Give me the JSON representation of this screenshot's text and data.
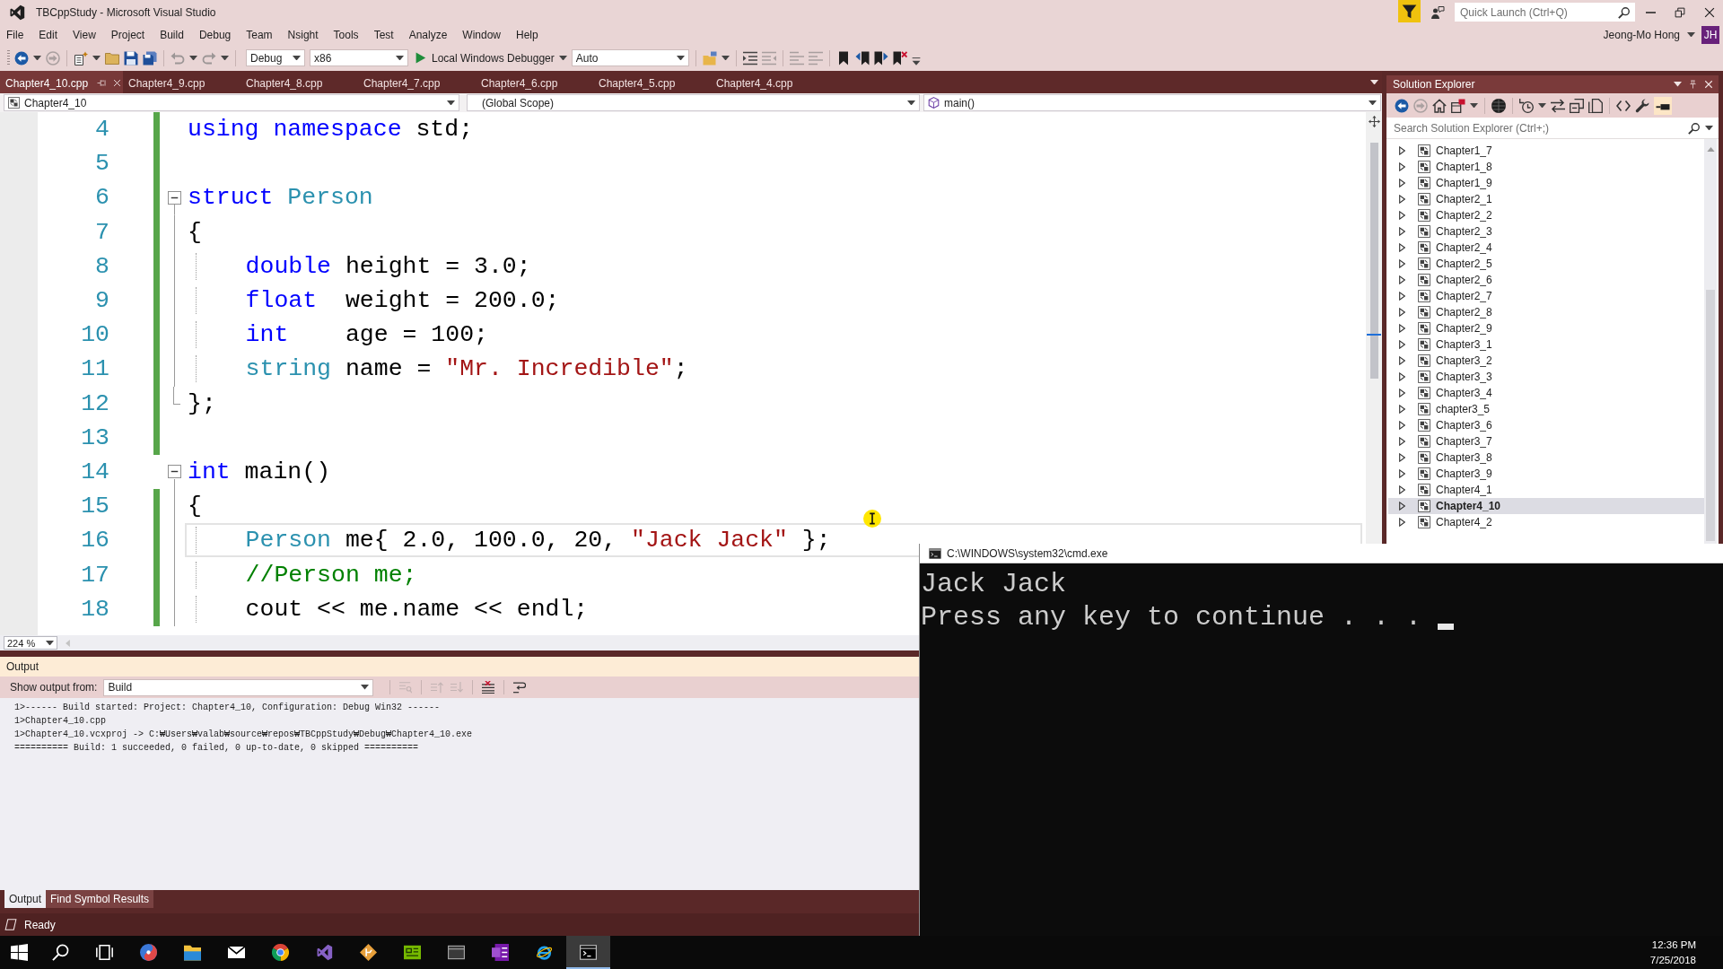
{
  "window": {
    "title": "TBCppStudy - Microsoft Visual Studio",
    "quick_launch": {
      "placeholder": "Quick Launch (Ctrl+Q)"
    },
    "user": {
      "name": "Jeong-Mo Hong",
      "initials": "JH"
    }
  },
  "menu": [
    "File",
    "Edit",
    "View",
    "Project",
    "Build",
    "Debug",
    "Team",
    "Nsight",
    "Tools",
    "Test",
    "Analyze",
    "Window",
    "Help"
  ],
  "toolbar": {
    "configuration": "Debug",
    "platform": "x86",
    "debugger": "Local Windows Debugger",
    "mode": "Auto"
  },
  "tabs": [
    {
      "label": "Chapter4_10.cpp",
      "selected": true
    },
    {
      "label": "Chapter4_9.cpp",
      "selected": false
    },
    {
      "label": "Chapter4_8.cpp",
      "selected": false
    },
    {
      "label": "Chapter4_7.cpp",
      "selected": false
    },
    {
      "label": "Chapter4_6.cpp",
      "selected": false
    },
    {
      "label": "Chapter4_5.cpp",
      "selected": false
    },
    {
      "label": "Chapter4_4.cpp",
      "selected": false
    }
  ],
  "navigation": {
    "project": "Chapter4_10",
    "scope": "(Global Scope)",
    "member": "main()"
  },
  "editor": {
    "lines": [
      {
        "number": "4",
        "kind": "plain",
        "modified": true,
        "current": false,
        "indented": false,
        "tokens": [
          {
            "kind": "keyword",
            "text": "using namespace"
          },
          {
            "kind": "plain",
            "text": " std;"
          }
        ]
      },
      {
        "number": "5",
        "kind": "plain",
        "modified": true,
        "current": false,
        "indented": false
      },
      {
        "number": "6",
        "kind": "block_start",
        "modified": true,
        "current": false,
        "indented": false,
        "tokens": [
          {
            "kind": "keyword",
            "text": "struct"
          },
          {
            "kind": "type",
            "text": " Person"
          }
        ]
      },
      {
        "number": "7",
        "kind": "block_line",
        "modified": true,
        "current": false,
        "indented": false,
        "tokens": [
          {
            "kind": "plain",
            "text": "{"
          }
        ]
      },
      {
        "number": "8",
        "kind": "block_line",
        "modified": true,
        "current": false,
        "indented": true,
        "tokens": [
          {
            "kind": "keyword",
            "text": "double"
          },
          {
            "kind": "plain",
            "text": " height = 3.0;"
          }
        ]
      },
      {
        "number": "9",
        "kind": "block_line",
        "modified": true,
        "current": false,
        "indented": true,
        "tokens": [
          {
            "kind": "keyword",
            "text": "float"
          },
          {
            "kind": "plain",
            "text": "  weight = 200.0;"
          }
        ]
      },
      {
        "number": "10",
        "kind": "block_line",
        "modified": true,
        "current": false,
        "indented": true,
        "tokens": [
          {
            "kind": "keyword",
            "text": "int"
          },
          {
            "kind": "plain",
            "text": "    age = 100;"
          }
        ]
      },
      {
        "number": "11",
        "kind": "block_line",
        "modified": true,
        "current": false,
        "indented": true,
        "tokens": [
          {
            "kind": "type",
            "text": "string"
          },
          {
            "kind": "plain",
            "text": " name = "
          },
          {
            "kind": "string",
            "text": "\"Mr. Incredible\""
          },
          {
            "kind": "plain",
            "text": ";"
          }
        ]
      },
      {
        "number": "12",
        "kind": "block_end",
        "modified": true,
        "current": false,
        "indented": false,
        "tokens": [
          {
            "kind": "plain",
            "text": "};"
          }
        ]
      },
      {
        "number": "13",
        "kind": "plain",
        "modified": true,
        "current": false,
        "indented": false
      },
      {
        "number": "14",
        "kind": "block_start",
        "modified": false,
        "current": false,
        "indented": false,
        "tokens": [
          {
            "kind": "keyword",
            "text": "int"
          },
          {
            "kind": "plain",
            "text": " main()"
          }
        ]
      },
      {
        "number": "15",
        "kind": "block_line",
        "modified": true,
        "current": false,
        "indented": false,
        "tokens": [
          {
            "kind": "plain",
            "text": "{"
          }
        ]
      },
      {
        "number": "16",
        "kind": "block_line",
        "modified": true,
        "current": true,
        "indented": true,
        "tokens": [
          {
            "kind": "type",
            "text": "Person"
          },
          {
            "kind": "plain",
            "text": " me{ 2.0, 100.0, 20, "
          },
          {
            "kind": "string",
            "text": "\"Jack Jack\""
          },
          {
            "kind": "plain",
            "text": " };"
          }
        ]
      },
      {
        "number": "17",
        "kind": "block_line",
        "modified": true,
        "current": false,
        "indented": true,
        "tokens": [
          {
            "kind": "comment",
            "text": "//Person me;"
          }
        ]
      },
      {
        "number": "18",
        "kind": "block_line",
        "modified": true,
        "current": false,
        "indented": true,
        "tokens": [
          {
            "kind": "plain",
            "text": "cout << me.name << endl;"
          }
        ]
      }
    ],
    "zoom": "224 %"
  },
  "solution_explorer": {
    "title": "Solution Explorer",
    "search": {
      "placeholder": "Search Solution Explorer (Ctrl+;)"
    },
    "items": [
      {
        "label": "Chapter1_7",
        "expanded": false,
        "selected": false
      },
      {
        "label": "Chapter1_8",
        "expanded": false,
        "selected": false
      },
      {
        "label": "Chapter1_9",
        "expanded": false,
        "selected": false
      },
      {
        "label": "Chapter2_1",
        "expanded": false,
        "selected": false
      },
      {
        "label": "Chapter2_2",
        "expanded": false,
        "selected": false
      },
      {
        "label": "Chapter2_3",
        "expanded": false,
        "selected": false
      },
      {
        "label": "Chapter2_4",
        "expanded": false,
        "selected": false
      },
      {
        "label": "Chapter2_5",
        "expanded": false,
        "selected": false
      },
      {
        "label": "Chapter2_6",
        "expanded": false,
        "selected": false
      },
      {
        "label": "Chapter2_7",
        "expanded": false,
        "selected": false
      },
      {
        "label": "Chapter2_8",
        "expanded": false,
        "selected": false
      },
      {
        "label": "Chapter2_9",
        "expanded": false,
        "selected": false
      },
      {
        "label": "Chapter3_1",
        "expanded": false,
        "selected": false
      },
      {
        "label": "Chapter3_2",
        "expanded": false,
        "selected": false
      },
      {
        "label": "Chapter3_3",
        "expanded": false,
        "selected": false
      },
      {
        "label": "Chapter3_4",
        "expanded": false,
        "selected": false
      },
      {
        "label": "chapter3_5",
        "expanded": false,
        "selected": false
      },
      {
        "label": "Chapter3_6",
        "expanded": false,
        "selected": false
      },
      {
        "label": "Chapter3_7",
        "expanded": false,
        "selected": false
      },
      {
        "label": "Chapter3_8",
        "expanded": false,
        "selected": false
      },
      {
        "label": "Chapter3_9",
        "expanded": false,
        "selected": false
      },
      {
        "label": "Chapter4_1",
        "expanded": false,
        "selected": false
      },
      {
        "label": "Chapter4_10",
        "expanded": false,
        "selected": true
      },
      {
        "label": "Chapter4_2",
        "expanded": false,
        "selected": false
      }
    ]
  },
  "output": {
    "title": "Output",
    "source_label": "Show output from:",
    "source": "Build",
    "lines": [
      "1>------ Build started: Project: Chapter4_10, Configuration: Debug Win32 ------",
      "1>Chapter4_10.cpp",
      "1>Chapter4_10.vcxproj -> C:₩Users₩valab₩source₩repos₩TBCppStudy₩Debug₩Chapter4_10.exe",
      "========== Build: 1 succeeded, 0 failed, 0 up-to-date, 0 skipped =========="
    ],
    "tabs": [
      {
        "label": "Output",
        "selected": true
      },
      {
        "label": "Find Symbol Results",
        "selected": false
      }
    ]
  },
  "status_bar": {
    "text": "Ready"
  },
  "console": {
    "title": "C:\\WINDOWS\\system32\\cmd.exe",
    "lines": [
      "Jack Jack",
      "Press any key to continue . . ."
    ]
  },
  "taskbar": {
    "buttons": [
      {
        "kind": "start",
        "active": false
      },
      {
        "kind": "search",
        "active": false
      },
      {
        "kind": "task_view",
        "active": false
      },
      {
        "kind": "swirl",
        "active": false
      },
      {
        "kind": "files",
        "active": false
      },
      {
        "kind": "mail",
        "active": false
      },
      {
        "kind": "browser",
        "active": false
      },
      {
        "kind": "ide",
        "active": false
      },
      {
        "kind": "git",
        "active": false
      },
      {
        "kind": "board",
        "active": false
      },
      {
        "kind": "window",
        "active": false
      },
      {
        "kind": "notes",
        "active": false
      },
      {
        "kind": "web",
        "active": false
      },
      {
        "kind": "terminal",
        "active": true
      }
    ],
    "time": "12:36 PM",
    "date": "7/25/2018"
  }
}
